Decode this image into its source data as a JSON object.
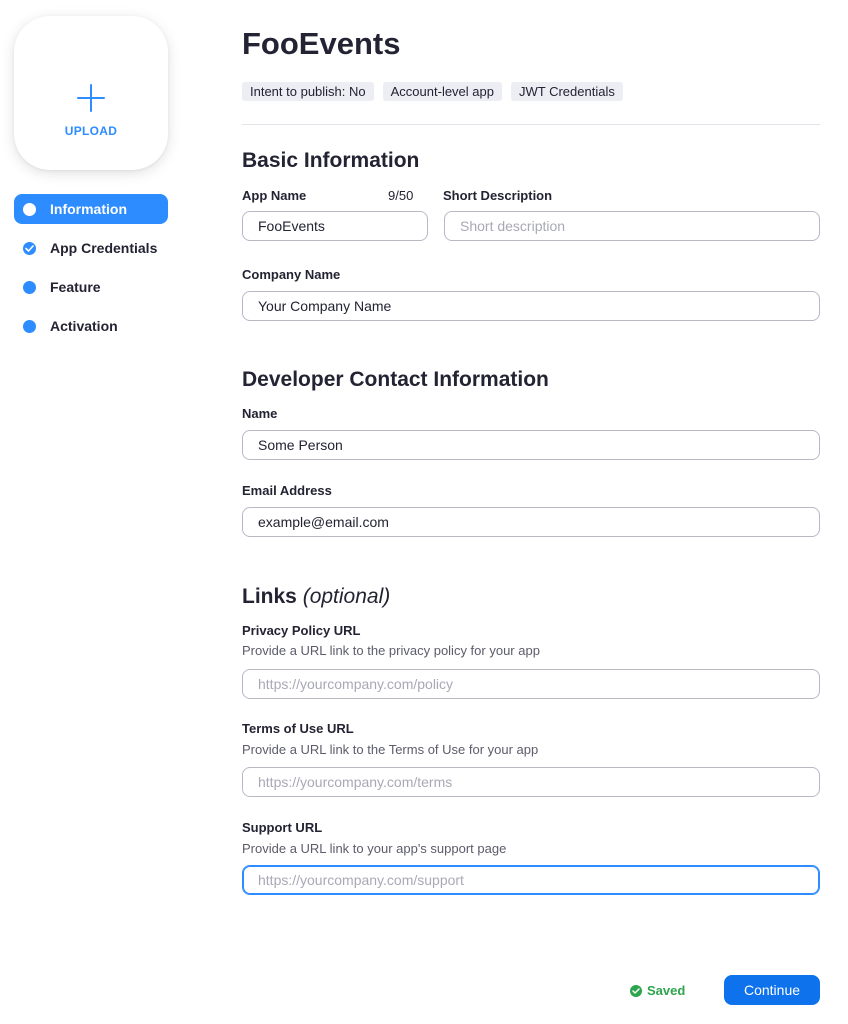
{
  "upload": {
    "label": "UPLOAD"
  },
  "nav": {
    "items": [
      {
        "label": "Information",
        "active": true
      },
      {
        "label": "App Credentials",
        "checked": true
      },
      {
        "label": "Feature"
      },
      {
        "label": "Activation"
      }
    ]
  },
  "app": {
    "title": "FooEvents",
    "tags": [
      "Intent to publish: No",
      "Account-level app",
      "JWT Credentials"
    ]
  },
  "basic": {
    "title": "Basic Information",
    "app_name_label": "App Name",
    "app_name_counter": "9/50",
    "app_name_value": "FooEvents",
    "short_desc_label": "Short Description",
    "short_desc_placeholder": "Short description",
    "company_label": "Company Name",
    "company_value": "Your Company Name"
  },
  "developer": {
    "title": "Developer Contact Information",
    "name_label": "Name",
    "name_value": "Some Person",
    "email_label": "Email Address",
    "email_value": "example@email.com"
  },
  "links": {
    "title": "Links",
    "optional": "(optional)",
    "privacy_label": "Privacy Policy URL",
    "privacy_helper": "Provide a URL link to the privacy policy for your app",
    "privacy_placeholder": "https://yourcompany.com/policy",
    "terms_label": "Terms of Use URL",
    "terms_helper": "Provide a URL link to the Terms of Use for your app",
    "terms_placeholder": "https://yourcompany.com/terms",
    "support_label": "Support URL",
    "support_helper": "Provide a URL link to your app's support page",
    "support_placeholder": "https://yourcompany.com/support"
  },
  "footer": {
    "saved": "Saved",
    "continue": "Continue"
  },
  "colors": {
    "accent": "#2d8cff",
    "button": "#0e72ed",
    "success": "#2da44e"
  }
}
